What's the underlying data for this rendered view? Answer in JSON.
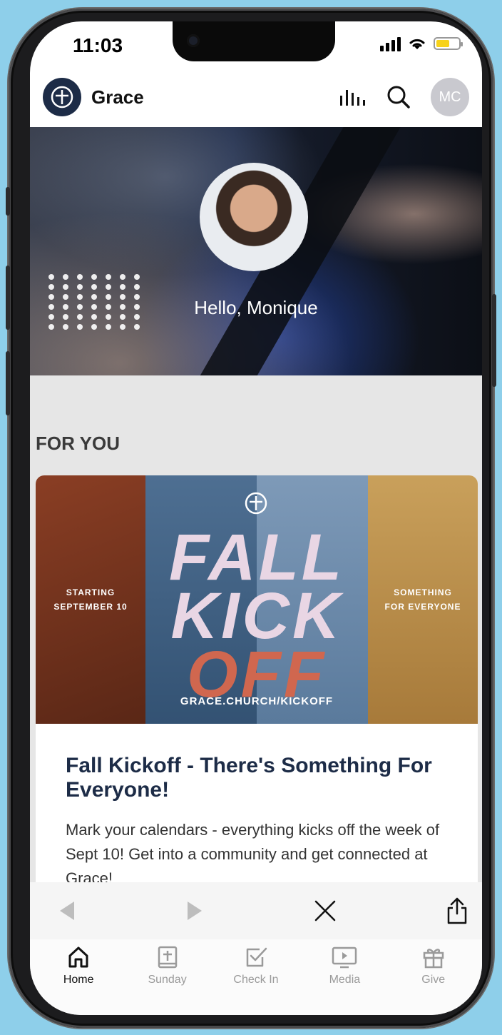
{
  "status_bar": {
    "time": "11:03"
  },
  "app_bar": {
    "title": "Grace",
    "avatar_initials": "MC"
  },
  "hero": {
    "greeting": "Hello, Monique"
  },
  "feed": {
    "section_title": "FOR YOU",
    "card": {
      "banner_left": "STARTING\nSEPTEMBER 10",
      "banner_word1": "FALL",
      "banner_word2": "KICK",
      "banner_word3": "OFF",
      "banner_right": "SOMETHING\nFOR EVERYONE",
      "banner_url": "GRACE.CHURCH/KICKOFF",
      "title": "Fall Kickoff - There's Something For Everyone!",
      "description": "Mark your calendars - everything kicks off the week of Sept 10! Get into a community and get connected at Grace!"
    }
  },
  "tabs": [
    {
      "label": "Home",
      "icon": "home-icon",
      "active": true
    },
    {
      "label": "Sunday",
      "icon": "bible-icon",
      "active": false
    },
    {
      "label": "Check In",
      "icon": "checkbox-icon",
      "active": false
    },
    {
      "label": "Media",
      "icon": "play-screen-icon",
      "active": false
    },
    {
      "label": "Give",
      "icon": "gift-icon",
      "active": false
    }
  ],
  "colors": {
    "brand": "#1d2c47",
    "background": "#8ecfea",
    "accent_off": "#d0674f"
  }
}
